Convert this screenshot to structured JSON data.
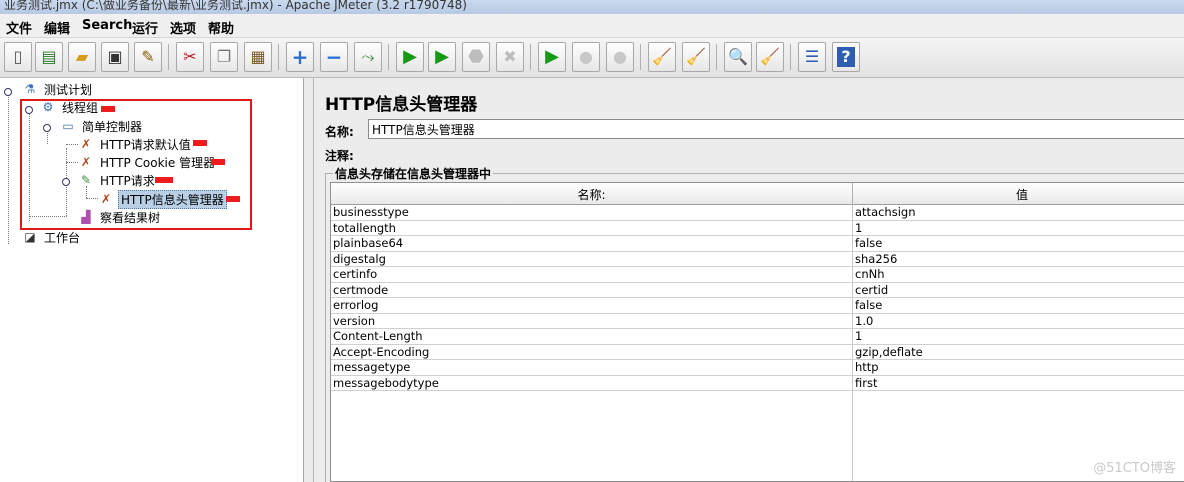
{
  "window": {
    "title": "业务测试.jmx (C:\\做业务备份\\最新\\业务测试.jmx) - Apache JMeter (3.2 r1790748)"
  },
  "menu": [
    "文件",
    "编辑",
    "Search",
    "运行",
    "选项",
    "帮助"
  ],
  "toolbar": [
    {
      "name": "new-icon",
      "glyph": "▯"
    },
    {
      "name": "templates-icon",
      "glyph": "▤"
    },
    {
      "name": "open-icon",
      "glyph": "▰"
    },
    {
      "name": "save-icon",
      "glyph": "▣"
    },
    {
      "name": "save-as-icon",
      "glyph": "✎"
    },
    {
      "name": "cut-icon",
      "glyph": "✂"
    },
    {
      "name": "copy-icon",
      "glyph": "❐"
    },
    {
      "name": "paste-icon",
      "glyph": "▦"
    },
    {
      "name": "expand-icon",
      "glyph": "+"
    },
    {
      "name": "collapse-icon",
      "glyph": "−"
    },
    {
      "name": "toggle-icon",
      "glyph": "⤳"
    },
    {
      "name": "start-icon",
      "glyph": "▶"
    },
    {
      "name": "start-no-pause-icon",
      "glyph": "▶"
    },
    {
      "name": "stop-icon",
      "glyph": "⬣"
    },
    {
      "name": "shutdown-icon",
      "glyph": "✖"
    },
    {
      "name": "remote-start-icon",
      "glyph": "▶"
    },
    {
      "name": "remote-stop-icon",
      "glyph": "●"
    },
    {
      "name": "remote-shutdown-icon",
      "glyph": "●"
    },
    {
      "name": "clear-icon",
      "glyph": "🧹"
    },
    {
      "name": "clear-all-icon",
      "glyph": "🧹"
    },
    {
      "name": "search-icon",
      "glyph": "🔍"
    },
    {
      "name": "reset-search-icon",
      "glyph": "🧹"
    },
    {
      "name": "function-helper-icon",
      "glyph": "☰"
    },
    {
      "name": "help-icon",
      "glyph": "?"
    }
  ],
  "tree": [
    {
      "label": "测试计划",
      "icon": "flask-icon",
      "glyph": "⚗",
      "marked": false
    },
    {
      "label": "线程组",
      "icon": "gear-icon",
      "glyph": "⚙",
      "marked": true
    },
    {
      "label": "简单控制器",
      "icon": "controller-icon",
      "glyph": "▭",
      "marked": false
    },
    {
      "label": "HTTP请求默认值",
      "icon": "wrench-icon",
      "glyph": "✗",
      "marked": true
    },
    {
      "label": "HTTP Cookie 管理器",
      "icon": "wrench-icon",
      "glyph": "✗",
      "marked": true
    },
    {
      "label": "HTTP请求",
      "icon": "pencil-icon",
      "glyph": "✎",
      "marked": true
    },
    {
      "label": "HTTP信息头管理器",
      "icon": "wrench-icon",
      "glyph": "✗",
      "marked": true
    },
    {
      "label": "察看结果树",
      "icon": "chart-icon",
      "glyph": "▟",
      "marked": false
    },
    {
      "label": "工作台",
      "icon": "workbench-icon",
      "glyph": "◪",
      "marked": false
    }
  ],
  "panel": {
    "title": "HTTP信息头管理器",
    "name_label": "名称:",
    "name_value": "HTTP信息头管理器",
    "comment_label": "注释:",
    "group_title": "信息头存储在信息头管理器中",
    "columns": [
      "名称:",
      "值"
    ],
    "rows": [
      [
        "businesstype",
        "attachsign"
      ],
      [
        "totallength",
        "1"
      ],
      [
        "plainbase64",
        "false"
      ],
      [
        "digestalg",
        "sha256"
      ],
      [
        "certinfo",
        "cnNh"
      ],
      [
        "certmode",
        "certid"
      ],
      [
        "errorlog",
        "false"
      ],
      [
        "version",
        "1.0"
      ],
      [
        "Content-Length",
        "1"
      ],
      [
        "Accept-Encoding",
        "gzip,deflate"
      ],
      [
        "messagetype",
        "http"
      ],
      [
        "messagebodytype",
        "first"
      ]
    ]
  },
  "watermark": "@51CTO博客"
}
